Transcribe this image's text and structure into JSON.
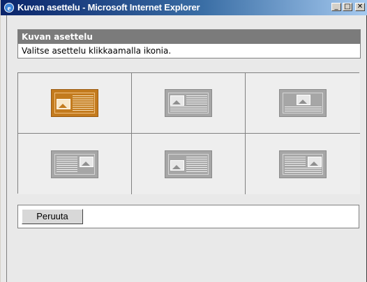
{
  "window": {
    "title": "Kuvan asettelu - Microsoft Internet Explorer",
    "controls": {
      "minimize": "_",
      "maximize": "□",
      "close": "✕"
    }
  },
  "panel": {
    "heading": "Kuvan asettelu",
    "instruction": "Valitse asettelu klikkaamalla ikonia."
  },
  "layouts": [
    {
      "name": "image-left",
      "selected": true
    },
    {
      "name": "image-left-text-around",
      "selected": false
    },
    {
      "name": "image-center-top",
      "selected": false
    },
    {
      "name": "image-right",
      "selected": false
    },
    {
      "name": "image-left-small",
      "selected": false
    },
    {
      "name": "image-right-text-around",
      "selected": false
    }
  ],
  "footer": {
    "cancel_label": "Peruuta"
  },
  "colors": {
    "selected": "#c37b1e",
    "unselected": "#a6a6a6",
    "header": "#7b7b7b"
  }
}
